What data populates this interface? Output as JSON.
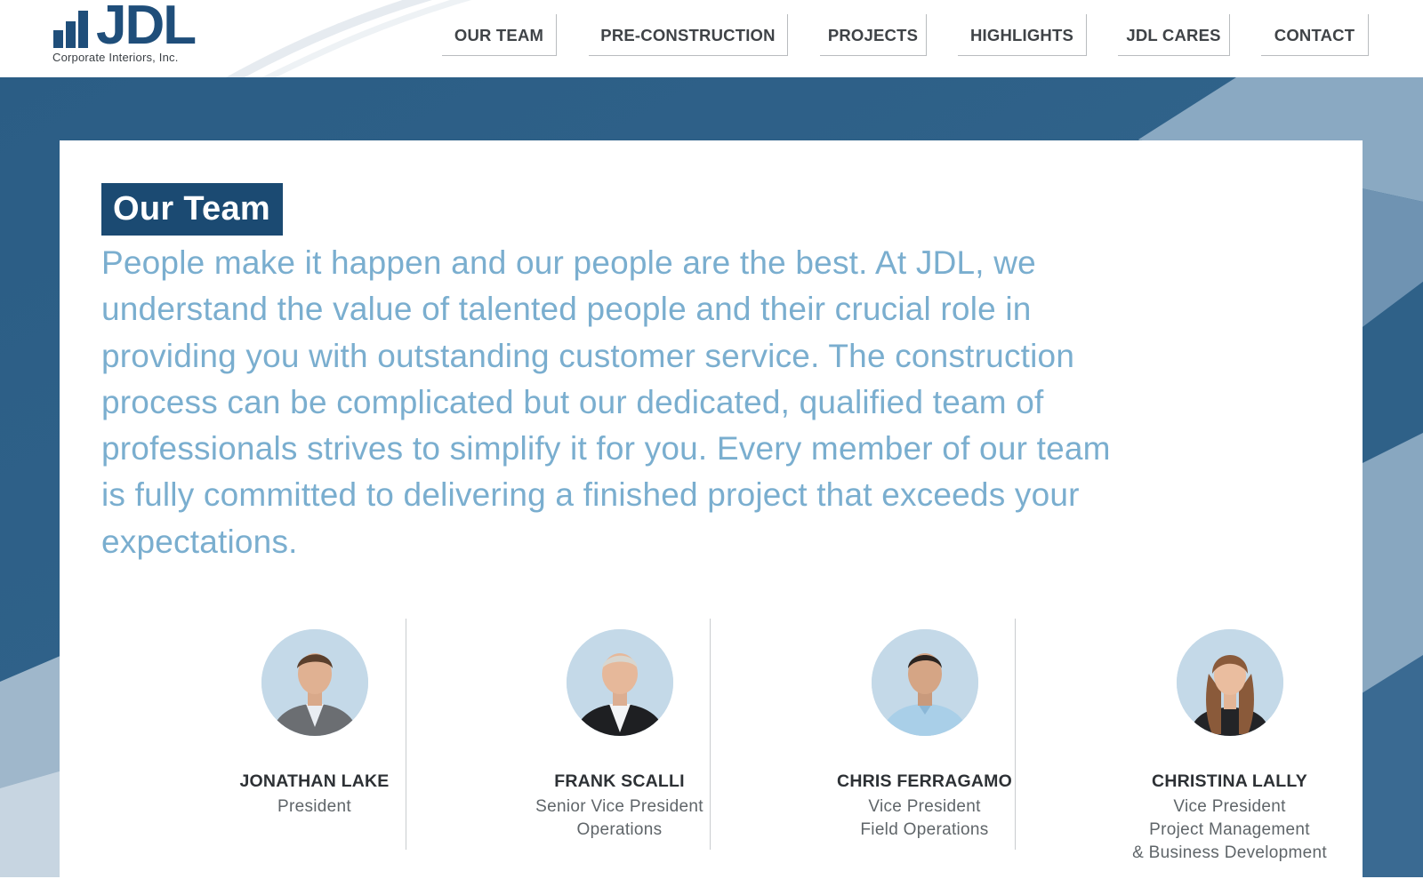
{
  "brand": {
    "logo_text": "JDL",
    "tagline": "Corporate Interiors, Inc.",
    "logo_color": "#1f4e7a"
  },
  "nav": {
    "items": [
      {
        "label": "OUR TEAM"
      },
      {
        "label": "PRE-CONSTRUCTION"
      },
      {
        "label": "PROJECTS"
      },
      {
        "label": "HIGHLIGHTS"
      },
      {
        "label": "JDL CARES"
      },
      {
        "label": "CONTACT"
      }
    ]
  },
  "page": {
    "title": "Our Team",
    "intro": "People make it happen and our people are the best. At JDL, we understand the value of talented people and their crucial role in providing you with outstanding customer service. The construction process can be complicated but our dedicated, qualified team of professionals strives to simplify it for you. Every member of our team is fully committed to delivering a finished project that exceeds your expectations."
  },
  "team": [
    {
      "name": "JONATHAN LAKE",
      "title_lines": [
        "President"
      ]
    },
    {
      "name": "FRANK SCALLI",
      "title_lines": [
        "Senior Vice President",
        "Operations"
      ]
    },
    {
      "name": "CHRIS FERRAGAMO",
      "title_lines": [
        "Vice President",
        "Field Operations"
      ]
    },
    {
      "name": "CHRISTINA LALLY",
      "title_lines": [
        "Vice President",
        "Project Management",
        "& Business Development"
      ]
    }
  ],
  "colors": {
    "title_badge_bg": "#1b4a72",
    "intro_text": "#7aaecf",
    "hero_bg": "#2f6188",
    "nav_text": "#3f4347"
  }
}
